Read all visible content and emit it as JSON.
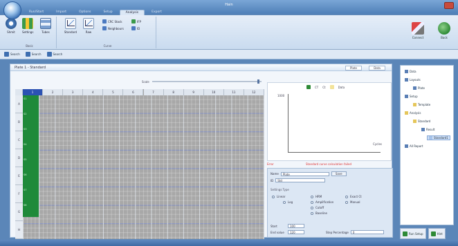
{
  "window": {
    "title": "Hain"
  },
  "ribbon": {
    "tabs": [
      "Run/Start",
      "Import",
      "Options",
      "Setup",
      "Analysis",
      "Export"
    ],
    "active_tab": "Analysis",
    "groups": [
      {
        "label": "Basic",
        "buttons": [
          "Shmit",
          "Settings",
          "Tubes"
        ]
      },
      {
        "label": "Curve",
        "buttons": [
          "Standard",
          "Raw"
        ],
        "small": [
          "CRC Stack",
          "Neighbours",
          "IFP",
          "ID"
        ]
      }
    ],
    "right_buttons": [
      "Connect",
      "Back"
    ]
  },
  "toolbar": {
    "items": [
      "Search",
      "Search",
      "Search"
    ]
  },
  "main": {
    "title": "Plate 1 - Standard",
    "head_buttons": [
      "Plate",
      "Data"
    ],
    "zoom_label": "Scale",
    "columns": [
      "1",
      "2",
      "3",
      "4",
      "5",
      "6",
      "7",
      "8",
      "9",
      "10",
      "11",
      "12"
    ],
    "rows": [
      "A",
      "B",
      "C",
      "D",
      "E",
      "F",
      "G",
      "H"
    ],
    "well_tags": [
      "S1",
      "S2",
      "S3",
      "S4",
      "S5",
      "S6",
      "S7",
      "S8"
    ]
  },
  "chart": {
    "legend": [
      "CT",
      "Ct",
      "Data"
    ],
    "y_tick": "1000",
    "x_tick": "Cycles",
    "red_label": "Error",
    "red_message": "Standard curve calculation failed"
  },
  "form": {
    "name_label": "Name",
    "name_value": "Plate",
    "name_button": "Save",
    "id_label": "ID",
    "id_value": "Std",
    "section_title": "Settings Type",
    "options": [
      "Linear",
      "Log",
      "HRM",
      "Amplification",
      "Cutoff",
      "Baseline",
      "Exact Ct",
      "Manual"
    ],
    "start_label": "Start",
    "start_value": "100",
    "end_label": "End value",
    "end_value": "120",
    "step_label": "Step Percentage",
    "step_value": "0"
  },
  "tree": {
    "items": [
      "Data",
      "Layouts",
      "Plate",
      "Setup",
      "Template",
      "Analysis",
      "Standard",
      "Result",
      "Standard1",
      "All Report"
    ],
    "selected": "Standard1"
  },
  "bottom_buttons": [
    "Run Setup",
    "Hint"
  ],
  "colors": {
    "accent": "#2b52b3",
    "well_green": "#1f8a3a",
    "error": "#dd3333"
  }
}
